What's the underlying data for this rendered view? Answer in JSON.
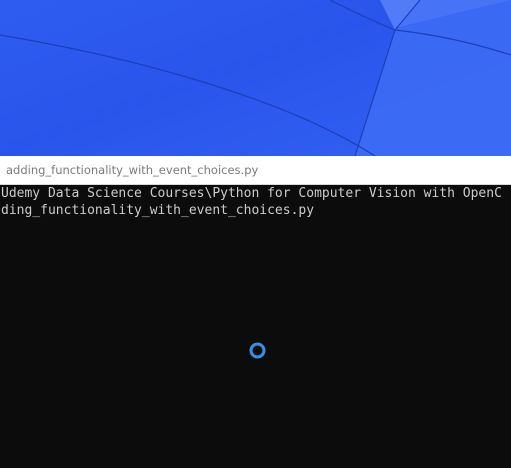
{
  "window": {
    "title": "adding_functionality_with_event_choices.py"
  },
  "console": {
    "lines": [
      "Udemy Data Science Courses\\Python for Computer Vision with OpenC",
      "ding_functionality_with_event_choices.py"
    ]
  },
  "loading": {
    "icon": "busy-spinner-icon",
    "color": "#3a8ee6"
  },
  "colors": {
    "wallpaper": "#2e5cf0",
    "console_bg": "#0c0c0c",
    "console_text": "#cccccc",
    "titlebar_bg": "#ffffff"
  }
}
